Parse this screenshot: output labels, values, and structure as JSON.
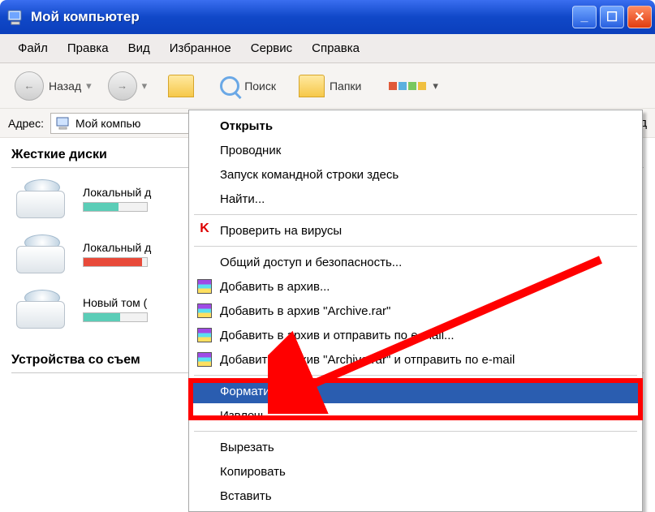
{
  "titlebar": {
    "title": "Мой компьютер"
  },
  "menubar": {
    "file": "Файл",
    "edit": "Правка",
    "view": "Вид",
    "favorites": "Избранное",
    "tools": "Сервис",
    "help": "Справка"
  },
  "toolbar": {
    "back": "Назад",
    "search": "Поиск",
    "folders": "Папки"
  },
  "addrbar": {
    "label": "Адрес:",
    "value": "Мой компью"
  },
  "addrbar_right": {
    "truncated": "д"
  },
  "content": {
    "section_drives": "Жесткие диски",
    "section_removable": "Устройства со съем",
    "drives": [
      {
        "label": "Локальный д",
        "fill": 55,
        "color": "fill-teal"
      },
      {
        "label": "Локальный д",
        "fill": 92,
        "color": "fill-red"
      },
      {
        "label": "Новый том (",
        "fill": 58,
        "color": "fill-teal"
      }
    ]
  },
  "ctx": {
    "open": "Открыть",
    "explorer": "Проводник",
    "cmd": "Запуск командной строки здесь",
    "find": "Найти...",
    "virus": "Проверить на вирусы",
    "sharing": "Общий доступ и безопасность...",
    "rar1": "Добавить в архив...",
    "rar2": "Добавить в архив \"Archive.rar\"",
    "rar3": "Добавить в архив и отправить по e-mail...",
    "rar4": "Добавить в архив \"Archive.rar\" и отправить по e-mail",
    "format": "Форматировать...",
    "eject": "Извлечь",
    "cut": "Вырезать",
    "copy": "Копировать",
    "paste": "Вставить"
  },
  "colors": {
    "highlight": "#2a5db0",
    "annotation": "#ff0000"
  }
}
